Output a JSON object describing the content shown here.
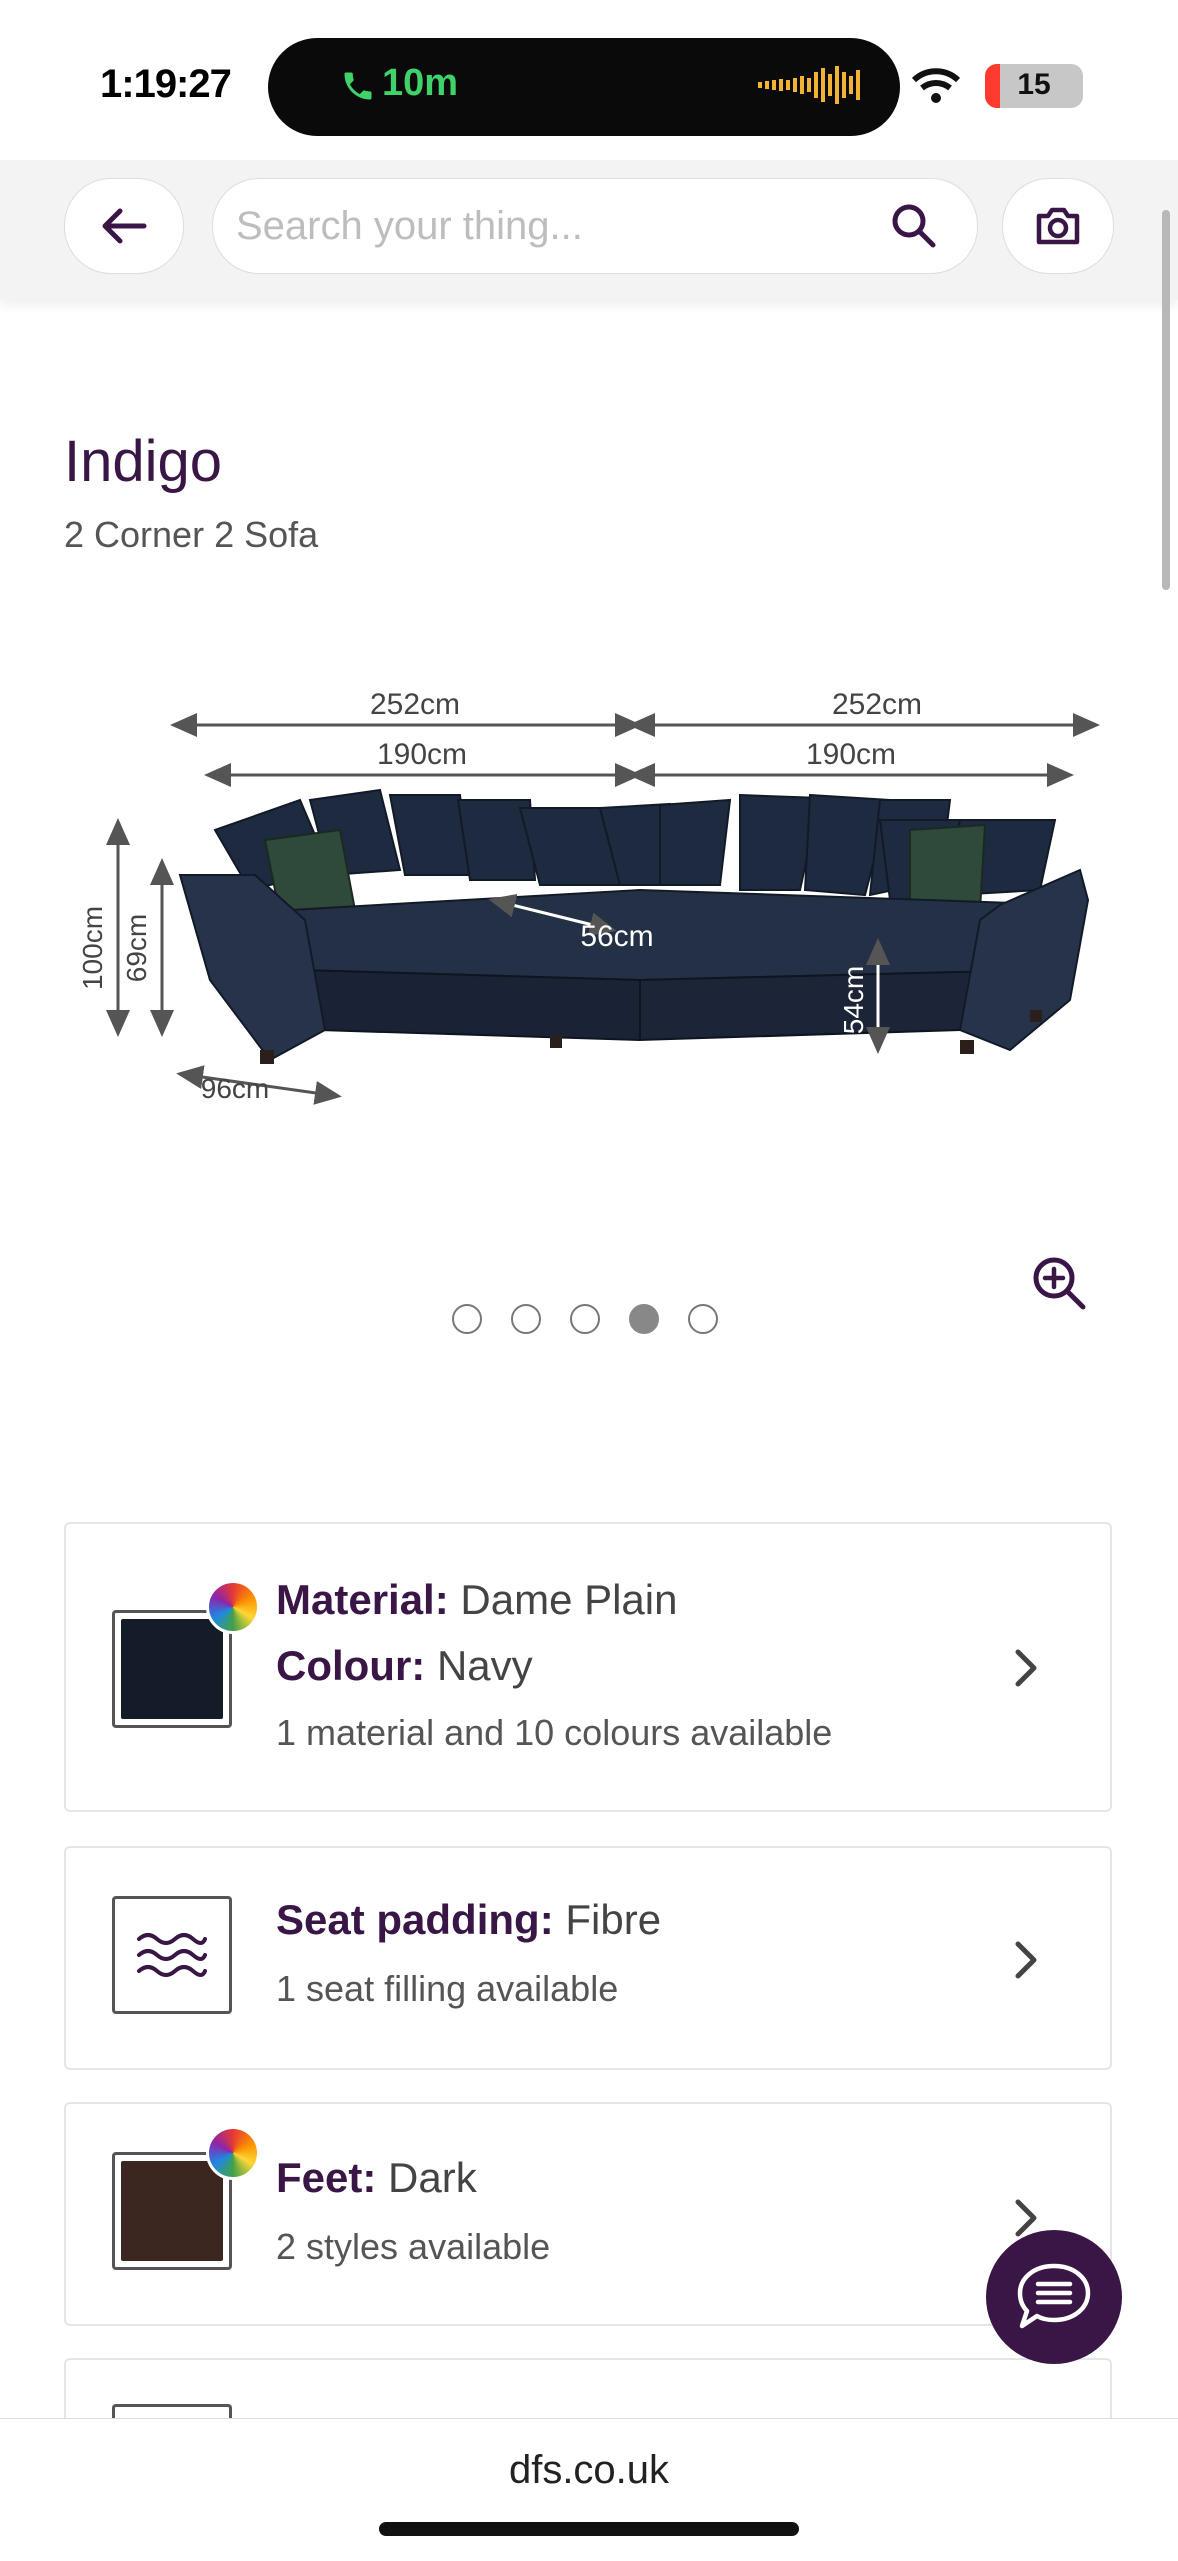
{
  "status_bar": {
    "time": "1:19:27",
    "call_duration": "10m",
    "battery": "15",
    "battery_level": 0.15
  },
  "search": {
    "placeholder": "Search your thing..."
  },
  "product": {
    "name": "Indigo",
    "type": "2 Corner 2 Sofa"
  },
  "dimensions": {
    "top_left_outer": "252cm",
    "top_right_outer": "252cm",
    "top_left_inner": "190cm",
    "top_right_inner": "190cm",
    "height_total": "100cm",
    "height_back": "69cm",
    "seat_depth": "56cm",
    "seat_height": "54cm",
    "depth": "96cm"
  },
  "carousel": {
    "total": 5,
    "active_index": 3
  },
  "options": [
    {
      "swatch_color": "#141c2a",
      "line1_label": "Material:",
      "line1_value": " Dame Plain",
      "line2_label": "Colour:",
      "line2_value": " Navy",
      "sub": "1 material and 10 colours available"
    },
    {
      "icon": "waves-icon",
      "line1_label": "Seat padding:",
      "line1_value": " Fibre",
      "sub": "1 seat filling available"
    },
    {
      "swatch_color": "#3b2620",
      "line1_label": "Feet:",
      "line1_value": " Dark",
      "sub": "2 styles available"
    }
  ],
  "footer": {
    "domain": "dfs.co.uk"
  },
  "colors": {
    "brand": "#3a1646",
    "call_green": "#3fd26a"
  }
}
